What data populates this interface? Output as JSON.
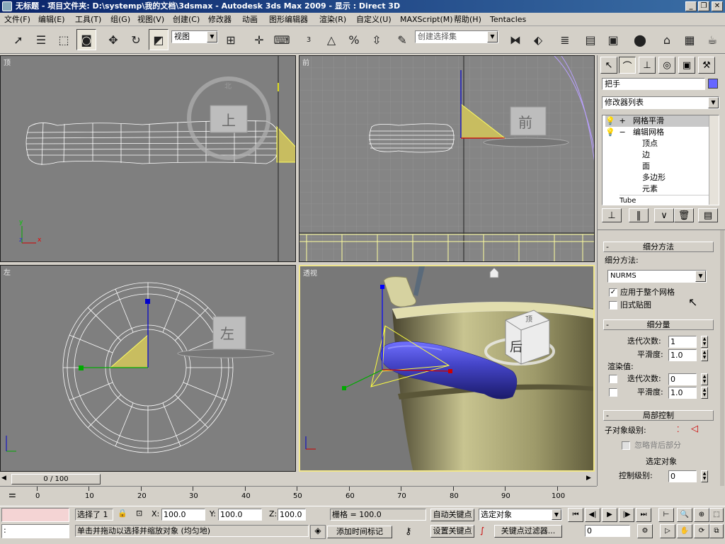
{
  "window": {
    "title": "无标题    - 项目文件夹: D:\\systemp\\我的文档\\3dsmax    - Autodesk 3ds Max  2009     - 显示 : Direct 3D",
    "minimize": "_",
    "restore": "❐",
    "close": "✕"
  },
  "menu": [
    "文件(F)",
    "编辑(E)",
    "工具(T)",
    "组(G)",
    "视图(V)",
    "创建(C)",
    "修改器",
    "动画",
    "图形编辑器",
    "渲染(R)",
    "自定义(U)",
    "MAXScript(M)",
    "帮助(H)",
    "Tentacles"
  ],
  "toolbar": {
    "ref_coord": "视图",
    "selection_set_placeholder": "创建选择集",
    "snap_label": "3",
    "spinner_snap_label": "%"
  },
  "viewports": {
    "top": {
      "label": "顶",
      "cube_face": "上",
      "compass_n": "北"
    },
    "front": {
      "label": "前",
      "cube_face": "前"
    },
    "left": {
      "label": "左",
      "cube_face": "左"
    },
    "perspective": {
      "label": "透视",
      "cube_face": "后",
      "cube_top": "顶"
    }
  },
  "axis_labels": {
    "x": "x",
    "y": "y",
    "z": "z"
  },
  "command_panel": {
    "object_name": "把手",
    "object_color": "#6666ff",
    "modifier_list": "修改器列表",
    "stack": [
      {
        "name": "网格平滑",
        "level": 0,
        "expander": "+",
        "selected": true
      },
      {
        "name": "编辑网格",
        "level": 0,
        "expander": "−",
        "selected": false
      },
      {
        "name": "顶点",
        "level": 1
      },
      {
        "name": "边",
        "level": 1
      },
      {
        "name": "面",
        "level": 1
      },
      {
        "name": "多边形",
        "level": 1
      },
      {
        "name": "元素",
        "level": 1
      },
      {
        "name": "Tube",
        "level": -1
      }
    ],
    "rollouts": {
      "subdivision_method": {
        "title": "细分方法",
        "method_label": "细分方法:",
        "method_value": "NURMS",
        "apply_whole_mesh": "应用于整个网格",
        "apply_whole_mesh_checked": true,
        "old_style_mapping": "旧式贴图",
        "old_style_mapping_checked": false
      },
      "subdivision_amount": {
        "title": "细分量",
        "iterations_label": "迭代次数:",
        "iterations_value": "1",
        "smoothness_label": "平滑度:",
        "smoothness_value": "1.0",
        "render_values_label": "渲染值:",
        "render_iterations_label": "迭代次数:",
        "render_iterations_value": "0",
        "render_smoothness_label": "平滑度:",
        "render_smoothness_value": "1.0"
      },
      "local_control": {
        "title": "局部控制",
        "sublevel_label": "子对象级别:",
        "ignore_backfacing": "忽略背后部分",
        "selected_object": "选定对象",
        "control_level_label": "控制级别:",
        "control_level_value": "0"
      }
    }
  },
  "timeline": {
    "current": "0 / 100",
    "ticks": [
      "0",
      "10",
      "20",
      "30",
      "40",
      "50",
      "60",
      "70",
      "80",
      "90",
      "100"
    ]
  },
  "status": {
    "selection": "选择了 1",
    "x_label": "X:",
    "x_value": "100.0",
    "y_label": "Y:",
    "y_value": "100.0",
    "z_label": "Z:",
    "z_value": "100.0",
    "grid": "栅格 = 100.0",
    "prompt": "单击并拖动以选择并缩放对象 (均匀地)",
    "add_time_tag": "添加时间标记",
    "auto_key": "自动关键点",
    "set_key": "设置关键点",
    "key_mode": "选定对象",
    "key_filters": "关键点过滤器...",
    "frame": "0",
    "maxscript_prompt": ":"
  },
  "colors": {
    "viewport_bg": "#7f7f7f",
    "active_border": "#f0e68c",
    "bucket": "#c8c490",
    "handle": "#4545c8",
    "wire": "#ffffff"
  }
}
